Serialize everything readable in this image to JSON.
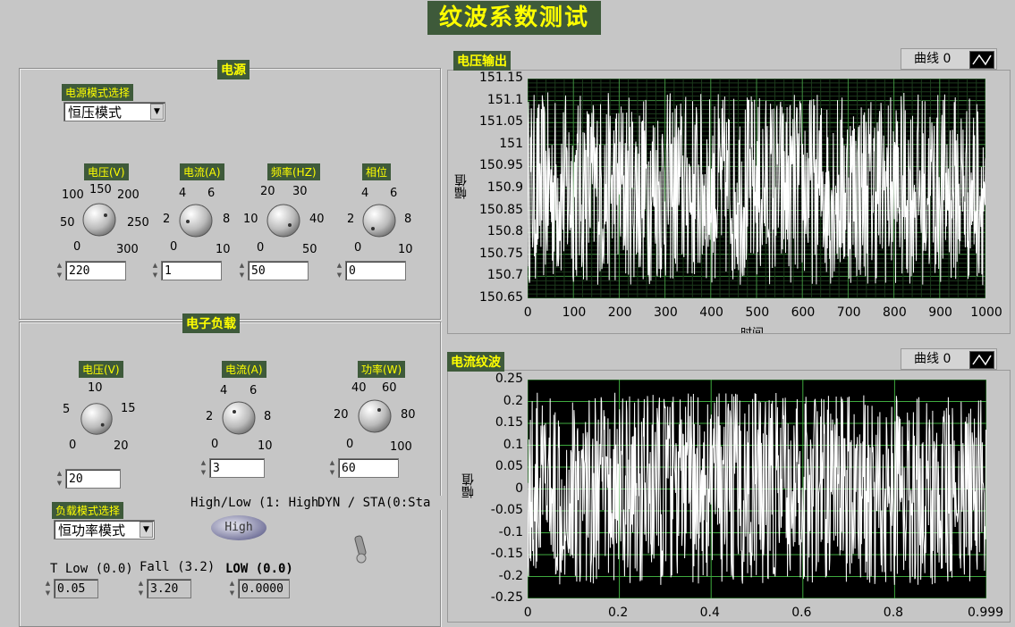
{
  "title": "纹波系数测试",
  "power": {
    "section_label": "电源",
    "mode_label": "电源模式选择",
    "mode_value": "恒压模式",
    "knobs": [
      {
        "label": "电压(V)",
        "ticks": [
          "0",
          "50",
          "100",
          "150",
          "200",
          "250",
          "300"
        ],
        "value": "220"
      },
      {
        "label": "电流(A)",
        "ticks": [
          "0",
          "2",
          "4",
          "6",
          "8",
          "10"
        ],
        "value": "1"
      },
      {
        "label": "频率(HZ)",
        "ticks": [
          "0",
          "10",
          "20",
          "30",
          "40",
          "50"
        ],
        "value": "50"
      },
      {
        "label": "相位",
        "ticks": [
          "0",
          "2",
          "4",
          "6",
          "8",
          "10"
        ],
        "value": "0"
      }
    ]
  },
  "load": {
    "section_label": "电子负载",
    "mode_label": "负载模式选择",
    "mode_value": "恒功率模式",
    "knobs": [
      {
        "label": "电压(V)",
        "ticks": [
          "0",
          "5",
          "10",
          "15",
          "20"
        ],
        "value": "20"
      },
      {
        "label": "电流(A)",
        "ticks": [
          "0",
          "2",
          "4",
          "6",
          "8",
          "10"
        ],
        "value": "3"
      },
      {
        "label": "功率(W)",
        "ticks": [
          "0",
          "20",
          "40",
          "60",
          "80",
          "100"
        ],
        "value": "60"
      }
    ],
    "highlow_label": "High/Low (1: High)",
    "highlow_value": "High",
    "dyn_label": "DYN / STA(0:Sta",
    "tlow_label": "T Low (0.0)",
    "tlow_value": "0.05",
    "fall_label": "Fall (3.2)",
    "fall_value": "3.20",
    "low_label": "LOW (0.0)",
    "low_value": "0.0000"
  },
  "chart_data": [
    {
      "type": "line",
      "title": "电压输出",
      "ylabel": "幅值",
      "xlabel": "时间",
      "legend": "曲线 0",
      "xlim": [
        0,
        1000
      ],
      "ylim": [
        150.65,
        151.15
      ],
      "x_ticks": [
        "0",
        "100",
        "200",
        "300",
        "400",
        "500",
        "600",
        "700",
        "800",
        "900",
        "1000"
      ],
      "y_ticks": [
        "151.15",
        "151.1",
        "151.05",
        "151",
        "150.95",
        "150.9",
        "150.85",
        "150.8",
        "150.75",
        "150.7",
        "150.65"
      ],
      "series_note": "random ripple between ~150.68 and ~151.12",
      "series": [
        {
          "range": [
            150.68,
            151.12
          ],
          "points": 1000
        }
      ]
    },
    {
      "type": "line",
      "title": "电流纹波",
      "ylabel": "幅值",
      "legend": "曲线 0",
      "xlim": [
        0,
        0.999
      ],
      "ylim": [
        -0.25,
        0.25
      ],
      "x_ticks": [
        "0",
        "0.2",
        "0.4",
        "0.6",
        "0.8",
        "0.999"
      ],
      "y_ticks": [
        "0.25",
        "0.2",
        "0.15",
        "0.1",
        "0.05",
        "0",
        "-0.05",
        "-0.1",
        "-0.15",
        "-0.2",
        "-0.25"
      ],
      "series": [
        {
          "range": [
            -0.22,
            0.22
          ],
          "points": 1000
        }
      ]
    }
  ]
}
